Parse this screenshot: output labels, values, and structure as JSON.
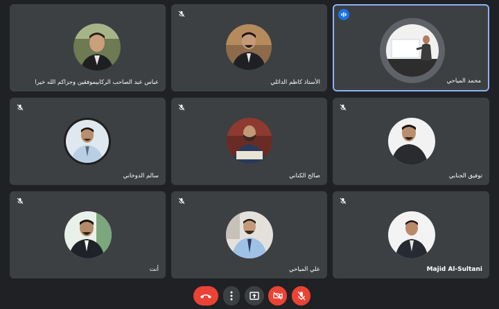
{
  "participants": [
    {
      "name": "عباس عبد الصاحب الركابيموفقين وجزاكم الله خيرا",
      "muted": false,
      "speaking": false
    },
    {
      "name": "الأستاذ كاظم الدائلي",
      "muted": true,
      "speaking": false
    },
    {
      "name": "محمد المياحي",
      "muted": false,
      "speaking": true
    },
    {
      "name": "سالم الدوخاني",
      "muted": true,
      "speaking": false
    },
    {
      "name": "صالح الكناني",
      "muted": true,
      "speaking": false
    },
    {
      "name": "توفيق الجنابي",
      "muted": true,
      "speaking": false
    },
    {
      "name": "أنت",
      "muted": true,
      "speaking": false
    },
    {
      "name": "علي المياحي",
      "muted": true,
      "speaking": false
    },
    {
      "name": "Majid Al-Sultani",
      "muted": true,
      "speaking": false
    }
  ],
  "controls": [
    {
      "name": "leave-call-icon",
      "color": "#ea4335"
    },
    {
      "name": "more-options-icon",
      "color": "#3c4043"
    },
    {
      "name": "present-screen-icon",
      "color": "#3c4043"
    },
    {
      "name": "camera-off-icon",
      "color": "#ea4335"
    },
    {
      "name": "mic-off-icon",
      "color": "#ea4335"
    }
  ],
  "colors": {
    "background": "#202124",
    "tile": "#3c4043",
    "active_speaker_border": "#8ab4f8",
    "danger": "#ea4335"
  }
}
